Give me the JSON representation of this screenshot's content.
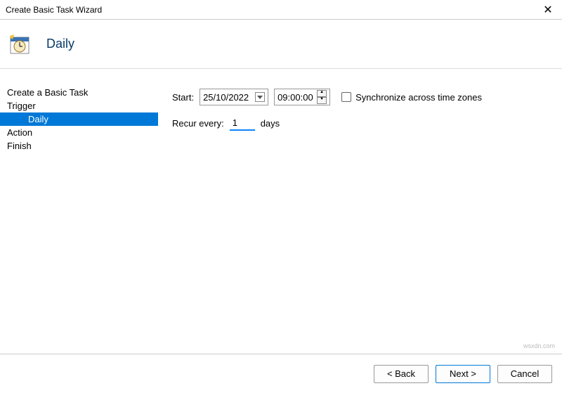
{
  "window": {
    "title": "Create Basic Task Wizard"
  },
  "header": {
    "title": "Daily"
  },
  "sidebar": {
    "items": [
      {
        "label": "Create a Basic Task",
        "indent": false,
        "selected": false
      },
      {
        "label": "Trigger",
        "indent": false,
        "selected": false
      },
      {
        "label": "Daily",
        "indent": true,
        "selected": true
      },
      {
        "label": "Action",
        "indent": false,
        "selected": false
      },
      {
        "label": "Finish",
        "indent": false,
        "selected": false
      }
    ]
  },
  "form": {
    "start_label": "Start:",
    "date": "25/10/2022",
    "time": "09:00:00",
    "sync_label": "Synchronize across time zones",
    "sync_checked": false,
    "recur_label": "Recur every:",
    "recur_value": "1",
    "recur_unit": "days"
  },
  "footer": {
    "back": "< Back",
    "next": "Next >",
    "cancel": "Cancel"
  },
  "watermark": "wsxdn.com"
}
